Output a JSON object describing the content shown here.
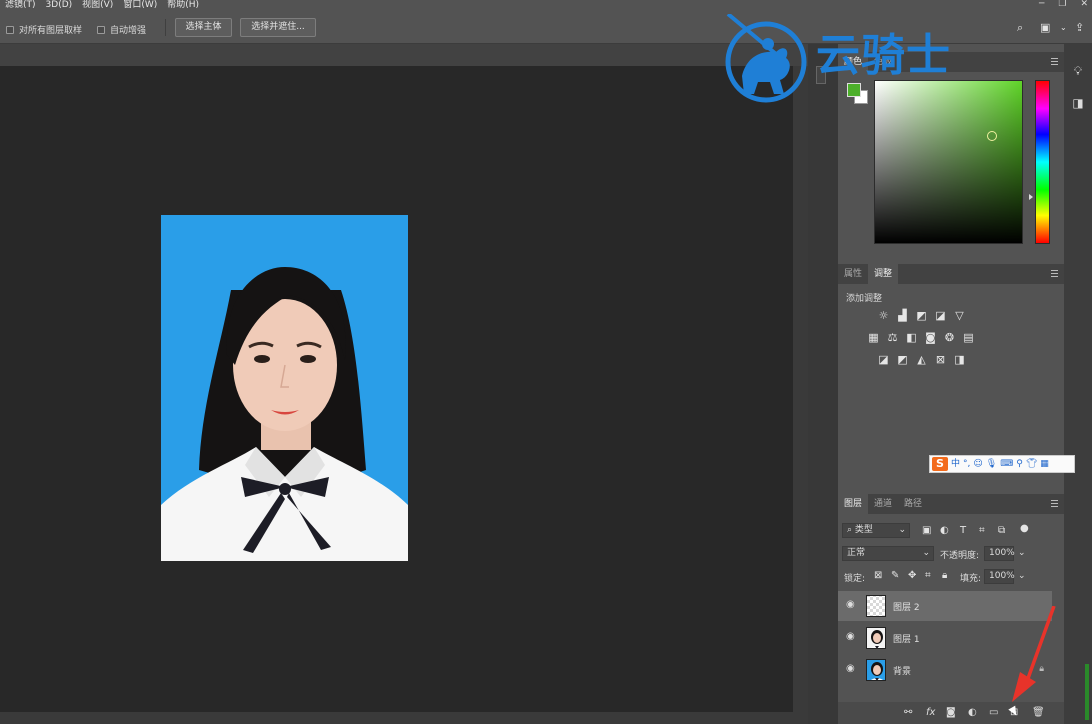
{
  "menubar": {
    "items": [
      "滤镜(T)",
      "3D(D)",
      "视图(V)",
      "窗口(W)",
      "帮助(H)"
    ]
  },
  "options": {
    "sample_all_layers": "对所有图层取样",
    "auto_enhance": "自动增强",
    "select_subject": "选择主体",
    "select_and_mask": "选择并遮住..."
  },
  "watermark": {
    "text": "云骑士",
    "color": "#1f7fd6"
  },
  "color_panel": {
    "tabs": [
      "颜色",
      "色板"
    ],
    "foreground": "#4caf2a",
    "background": "#ffffff"
  },
  "adjust_panel": {
    "tabs": [
      "属性",
      "调整"
    ],
    "add_label": "添加调整"
  },
  "layers_panel": {
    "tabs": [
      "图层",
      "通道",
      "路径"
    ],
    "filter_kind": "类型",
    "blend_mode": "正常",
    "opacity_label": "不透明度:",
    "opacity_value": "100%",
    "lock_label": "锁定:",
    "fill_label": "填充:",
    "fill_value": "100%",
    "layers": [
      {
        "name": "图层 2",
        "selected": true
      },
      {
        "name": "图层 1",
        "selected": false
      },
      {
        "name": "背景",
        "selected": false
      }
    ]
  },
  "ime": {
    "logo": "S",
    "mode": "中"
  },
  "colors": {
    "photo_bg": "#2a9ee8",
    "annotation": "#e8332a"
  }
}
